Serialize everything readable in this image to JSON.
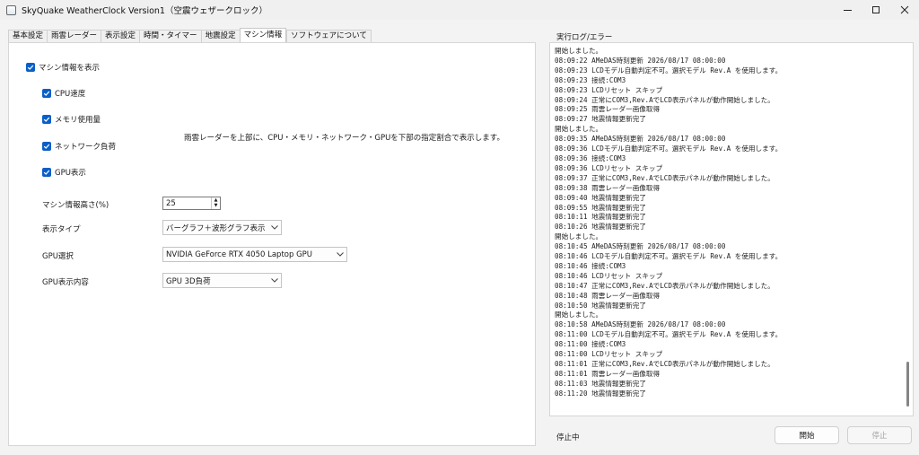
{
  "window": {
    "title": "SkyQuake WeatherClock Version1（空震ウェザークロック）",
    "minimize": "—",
    "maximize": "□",
    "close": "✕"
  },
  "tabs": [
    {
      "label": "基本設定"
    },
    {
      "label": "雨雲レーダー"
    },
    {
      "label": "表示設定"
    },
    {
      "label": "時間・タイマー"
    },
    {
      "label": "地震設定"
    },
    {
      "label": "マシン情報",
      "active": true
    },
    {
      "label": "ソフトウェアについて"
    }
  ],
  "machine": {
    "show_label": "マシン情報を表示",
    "show_checked": true,
    "cpu_label": "CPU速度",
    "mem_label": "メモリ使用量",
    "net_label": "ネットワーク負荷",
    "gpu_label": "GPU表示",
    "description": "雨雲レーダーを上部に、CPU・メモリ・ネットワーク・GPUを下部の指定割合で表示します。",
    "height_label": "マシン情報高さ(%)",
    "height_value": "25",
    "display_type_label": "表示タイプ",
    "display_type_value": "バーグラフ＋波形グラフ表示",
    "gpu_select_label": "GPU選択",
    "gpu_select_value": "NVIDIA GeForce RTX 4050 Laptop GPU",
    "gpu_content_label": "GPU表示内容",
    "gpu_content_value": "GPU 3D負荷"
  },
  "log": {
    "title": "実行ログ/エラー",
    "lines": [
      "開始しました。",
      "08:09:22 AMeDAS時刻更新 2026/08/17 08:00:00",
      "08:09:23 LCDモデル自動判定不可。選択モデル Rev.A を使用します。",
      "08:09:23 接続:COM3",
      "08:09:23 LCDリセット スキップ",
      "08:09:24 正常にCOM3,Rev.AでLCD表示パネルが動作開始しました。",
      "08:09:25 雨雲レーダー画像取得",
      "08:09:27 地震情報更新完了",
      "開始しました。",
      "08:09:35 AMeDAS時刻更新 2026/08/17 08:00:00",
      "08:09:36 LCDモデル自動判定不可。選択モデル Rev.A を使用します。",
      "08:09:36 接続:COM3",
      "08:09:36 LCDリセット スキップ",
      "08:09:37 正常にCOM3,Rev.AでLCD表示パネルが動作開始しました。",
      "08:09:38 雨雲レーダー画像取得",
      "08:09:40 地震情報更新完了",
      "08:09:55 地震情報更新完了",
      "08:10:11 地震情報更新完了",
      "08:10:26 地震情報更新完了",
      "開始しました。",
      "08:10:45 AMeDAS時刻更新 2026/08/17 08:00:00",
      "08:10:46 LCDモデル自動判定不可。選択モデル Rev.A を使用します。",
      "08:10:46 接続:COM3",
      "08:10:46 LCDリセット スキップ",
      "08:10:47 正常にCOM3,Rev.AでLCD表示パネルが動作開始しました。",
      "08:10:48 雨雲レーダー画像取得",
      "08:10:50 地震情報更新完了",
      "開始しました。",
      "08:10:58 AMeDAS時刻更新 2026/08/17 08:00:00",
      "08:11:00 LCDモデル自動判定不可。選択モデル Rev.A を使用します。",
      "08:11:00 接続:COM3",
      "08:11:00 LCDリセット スキップ",
      "08:11:01 正常にCOM3,Rev.AでLCD表示パネルが動作開始しました。",
      "08:11:01 雨雲レーダー画像取得",
      "08:11:03 地震情報更新完了",
      "08:11:20 地震情報更新完了"
    ]
  },
  "status": {
    "text": "停止中",
    "start_label": "開始",
    "stop_label": "停止"
  },
  "colors": {
    "accent": "#0a5fc7",
    "window_bg": "#f3f3f3"
  }
}
